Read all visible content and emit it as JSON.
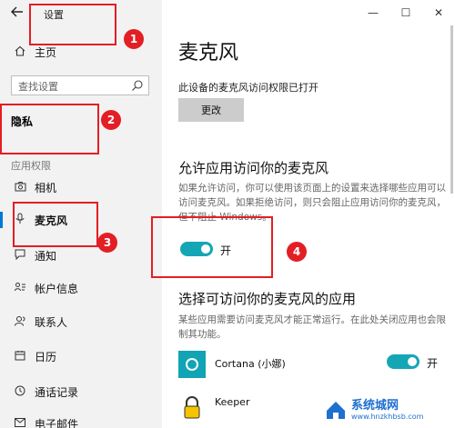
{
  "window": {
    "title": "设置",
    "controls": {
      "minimize": "—",
      "maximize": "☐",
      "close": "✕"
    }
  },
  "sidebar": {
    "back_icon": "back-arrow-icon",
    "home_label": "主页",
    "search_placeholder": "查找设置",
    "section": "隐私",
    "group_label": "应用权限",
    "items": [
      {
        "label": "相机",
        "icon": "camera-icon"
      },
      {
        "label": "麦克风",
        "icon": "microphone-icon",
        "active": true
      },
      {
        "label": "通知",
        "icon": "notification-icon"
      },
      {
        "label": "帐户信息",
        "icon": "account-info-icon"
      },
      {
        "label": "联系人",
        "icon": "contacts-icon"
      },
      {
        "label": "日历",
        "icon": "calendar-icon"
      },
      {
        "label": "通话记录",
        "icon": "call-history-icon"
      },
      {
        "label": "电子邮件",
        "icon": "email-icon"
      }
    ]
  },
  "main": {
    "title": "麦克风",
    "status_text": "此设备的麦克风访问权限已打开",
    "change_button": "更改",
    "allow_heading": "允许应用访问你的麦克风",
    "allow_desc": "如果允许访问，你可以使用该页面上的设置来选择哪些应用可以访问麦克风。如果拒绝访问，则只会阻止应用访问你的麦克风，但不阻止 Windows。",
    "allow_toggle_state": "开",
    "choose_heading": "选择可访问你的麦克风的应用",
    "choose_desc": "某些应用需要访问麦克风才能正常运行。在此处关闭应用也会限制其功能。",
    "apps": [
      {
        "name": "Cortana (小娜)",
        "toggle_state": "开",
        "tile_color": "#11a4b4"
      },
      {
        "name": "Keeper",
        "tile_color": "#ffffff"
      }
    ]
  },
  "annotations": [
    "1",
    "2",
    "3",
    "4"
  ],
  "watermark": {
    "title": "系统城网",
    "url": "www.hnzkhbsb.com"
  },
  "colors": {
    "accent": "#0078d7",
    "toggle": "#15a6b6",
    "annotation": "#e31e24",
    "sidebar_bg": "#f2f2f2"
  }
}
